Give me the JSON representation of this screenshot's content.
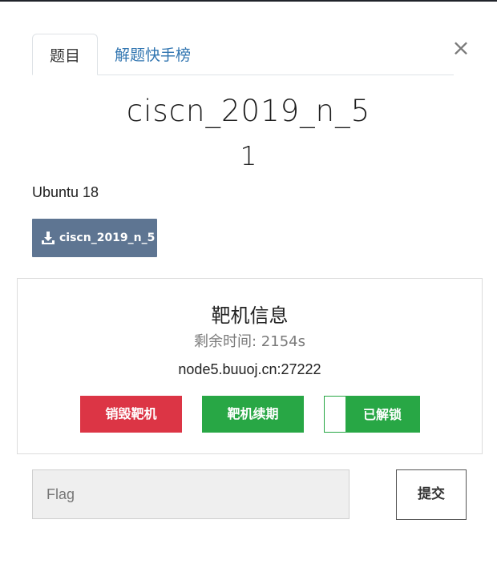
{
  "modal": {
    "close_label": "×",
    "tabs": [
      {
        "label": "题目",
        "active": true
      },
      {
        "label": "解题快手榜",
        "active": false
      }
    ],
    "challenge": {
      "name": "ciscn_2019_n_5",
      "points": "1",
      "description": "Ubuntu 18",
      "file_button_label": "ciscn_2019_n_5"
    },
    "target": {
      "title": "靶机信息",
      "remaining": "剩余时间: 2154s",
      "address": "node5.buuoj.cn:27222",
      "destroy_label": "销毁靶机",
      "renew_label": "靶机续期",
      "unlock_label": "已解锁"
    },
    "flag": {
      "placeholder": "Flag",
      "value": "",
      "submit_label": "提交"
    }
  },
  "colors": {
    "file_button": "#5e7592",
    "danger": "#dc3545",
    "success": "#28a745",
    "tab_link": "#3276b1"
  }
}
